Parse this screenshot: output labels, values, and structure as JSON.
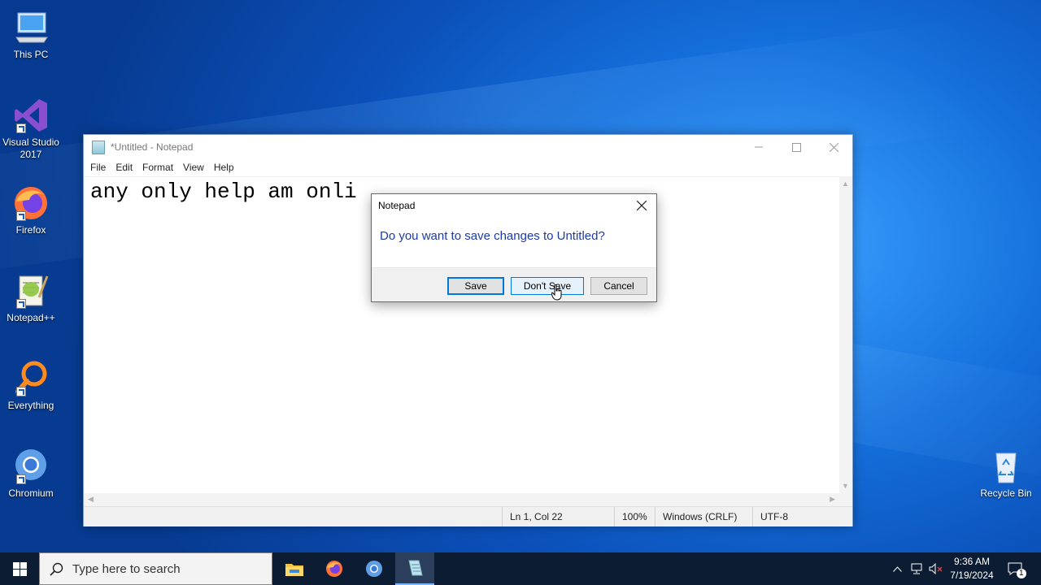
{
  "desktop": {
    "icons": [
      {
        "label": "This PC"
      },
      {
        "label": "Visual Studio 2017"
      },
      {
        "label": "Firefox"
      },
      {
        "label": "Notepad++"
      },
      {
        "label": "Everything"
      },
      {
        "label": "Chromium"
      },
      {
        "label": "Recycle Bin"
      }
    ]
  },
  "notepad": {
    "title": "*Untitled - Notepad",
    "menu": [
      "File",
      "Edit",
      "Format",
      "View",
      "Help"
    ],
    "content": "any only help am onli",
    "status": {
      "position": "Ln 1, Col 22",
      "zoom": "100%",
      "line_endings": "Windows (CRLF)",
      "encoding": "UTF-8"
    }
  },
  "dialog": {
    "title": "Notepad",
    "message": "Do you want to save changes to Untitled?",
    "buttons": {
      "save": "Save",
      "dont_save": "Don't Save",
      "cancel": "Cancel"
    }
  },
  "taskbar": {
    "search_placeholder": "Type here to search",
    "time": "9:36 AM",
    "date": "7/19/2024",
    "notification_count": "1"
  }
}
